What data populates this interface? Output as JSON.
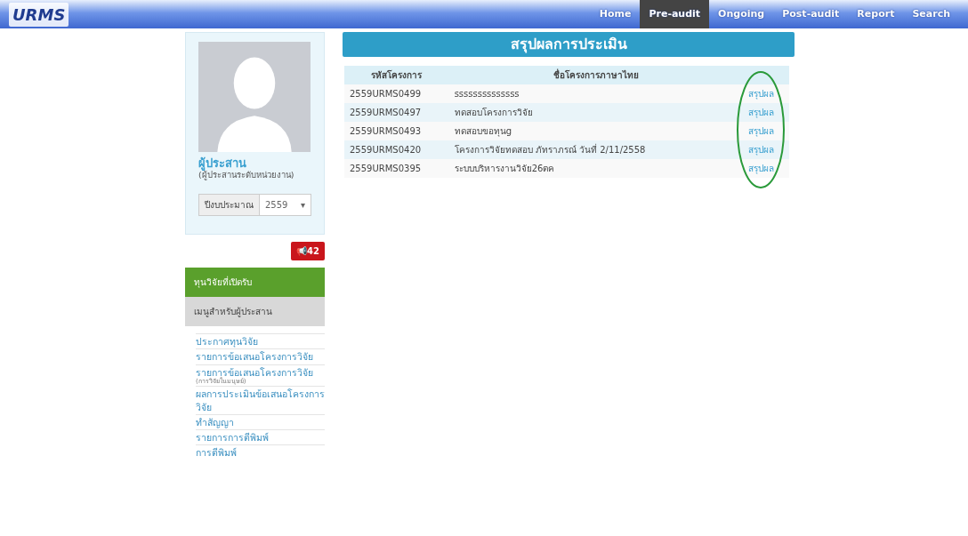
{
  "navbar": {
    "logo": "URMS",
    "items": [
      {
        "label": "Home",
        "selected": false
      },
      {
        "label": "Pre-audit",
        "selected": true
      },
      {
        "label": "Ongoing",
        "selected": false
      },
      {
        "label": "Post-audit",
        "selected": false
      },
      {
        "label": "Report",
        "selected": false
      },
      {
        "label": "Search",
        "selected": false
      }
    ]
  },
  "profile": {
    "name": "ผู้ประสาน",
    "role": "(ผู้ประสานระดับหน่วยงาน)",
    "year_label": "ปีงบประมาณ",
    "year": "2559",
    "caret": "▾"
  },
  "notification_button": {
    "icon": "📢",
    "count": "42"
  },
  "sidebar": {
    "funding_header": "ทุนวิจัยที่เปิดรับ",
    "menu_header": "เมนูสำหรับผู้ประสาน",
    "items": [
      {
        "label": "ประกาศทุนวิจัย"
      },
      {
        "label": "รายการข้อเสนอโครงการวิจัย"
      },
      {
        "label": "รายการข้อเสนอโครงการวิจัย",
        "note": "(การวิจัยในมนุษย์)"
      },
      {
        "label": "ผลการประเมินข้อเสนอโครงการวิจัย"
      },
      {
        "label": "ทำสัญญา"
      },
      {
        "label": "รายการการตีพิมพ์"
      },
      {
        "label": "การตีพิมพ์"
      }
    ]
  },
  "main": {
    "title": "สรุปผลการประเมิน",
    "columns": [
      "รหัสโครงการ",
      "ชื่อโครงการภาษาไทย"
    ],
    "rows": [
      {
        "code": "2559URMS0499",
        "name": "ssssssssssssss",
        "link": "สรุปผล"
      },
      {
        "code": "2559URMS0497",
        "name": "ทดสอบโครงการวิจัย",
        "link": "สรุปผล"
      },
      {
        "code": "2559URMS0493",
        "name": "ทดสอบขอทุนg",
        "link": "สรุปผล"
      },
      {
        "code": "2559URMS0420",
        "name": "โครงการวิจัยทดสอบ ภัทราภรณ์ วันที่ 2/11/2558",
        "link": "สรุปผล"
      },
      {
        "code": "2559URMS0395",
        "name": "ระบบบริหารงานวิจัย26ตค",
        "link": "สรุปผล"
      }
    ]
  }
}
